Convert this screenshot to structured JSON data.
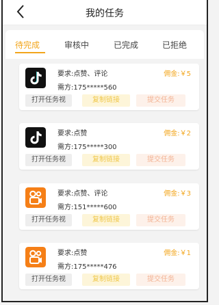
{
  "header": {
    "title": "我的任务"
  },
  "tabs": [
    {
      "label": "待完成",
      "active": true
    },
    {
      "label": "审核中",
      "active": false
    },
    {
      "label": "已完成",
      "active": false
    },
    {
      "label": "已拒绝",
      "active": false
    }
  ],
  "tasks": [
    {
      "app_icon": "tiktok-icon",
      "requirement": "要求:点赞、评论",
      "buyer": "需方:175*****560",
      "commission": "佣金:￥5",
      "open_label": "打开任务视",
      "copy_label": "复制链接",
      "submit_label": "提交任务"
    },
    {
      "app_icon": "tiktok-icon",
      "requirement": "要求:点赞",
      "buyer": "需方:175*****300",
      "commission": "佣金:￥2",
      "open_label": "打开任务视",
      "copy_label": "复制链接",
      "submit_label": "提交任务"
    },
    {
      "app_icon": "kuaishou-icon",
      "requirement": "要求:点赞、评论",
      "buyer": "需方:151*****600",
      "commission": "佣金:￥3",
      "open_label": "打开任务视",
      "copy_label": "复制链接",
      "submit_label": "提交任务"
    },
    {
      "app_icon": "kuaishou-icon",
      "requirement": "要求:点赞",
      "buyer": "需方:175*****476",
      "commission": "佣金:￥1",
      "open_label": "打开任务视",
      "copy_label": "复制链接",
      "submit_label": "提交任务"
    }
  ],
  "colors": {
    "accent": "#f2a51b",
    "kuaishou": "#f57f17",
    "tiktok": "#111111"
  }
}
